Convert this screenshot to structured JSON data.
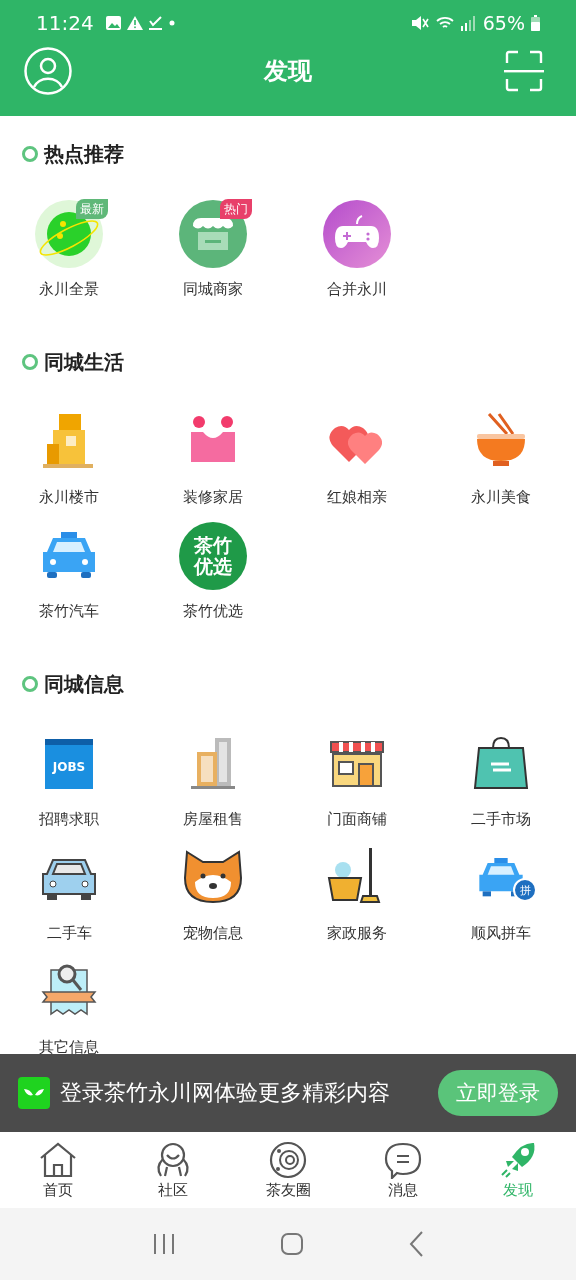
{
  "status_bar": {
    "time": "11:24",
    "battery": "65%"
  },
  "header": {
    "title": "发现"
  },
  "sections": [
    {
      "title": "热点推荐",
      "items": [
        {
          "label": "永川全景",
          "badge": {
            "text": "最新",
            "color": "#5fb878"
          }
        },
        {
          "label": "同城商家",
          "badge": {
            "text": "热门",
            "color": "#e8406a"
          }
        },
        {
          "label": "合并永川"
        }
      ]
    },
    {
      "title": "同城生活",
      "items": [
        {
          "label": "永川楼市"
        },
        {
          "label": "装修家居"
        },
        {
          "label": "红娘相亲"
        },
        {
          "label": "永川美食"
        },
        {
          "label": "茶竹汽车"
        },
        {
          "label": "茶竹优选",
          "icon_text": "茶竹优选"
        }
      ]
    },
    {
      "title": "同城信息",
      "items": [
        {
          "label": "招聘求职",
          "icon_text": "JOBS"
        },
        {
          "label": "房屋租售"
        },
        {
          "label": "门面商铺"
        },
        {
          "label": "二手市场"
        },
        {
          "label": "二手车"
        },
        {
          "label": "宠物信息"
        },
        {
          "label": "家政服务"
        },
        {
          "label": "顺风拼车",
          "icon_text": "拼"
        },
        {
          "label": "其它信息"
        }
      ]
    }
  ],
  "login_banner": {
    "message": "登录茶竹永川网体验更多精彩内容",
    "button": "立即登录"
  },
  "tab_bar": [
    {
      "label": "首页",
      "selected": false
    },
    {
      "label": "社区",
      "selected": false
    },
    {
      "label": "茶友圈",
      "selected": false
    },
    {
      "label": "消息",
      "selected": false
    },
    {
      "label": "发现",
      "selected": true
    }
  ]
}
